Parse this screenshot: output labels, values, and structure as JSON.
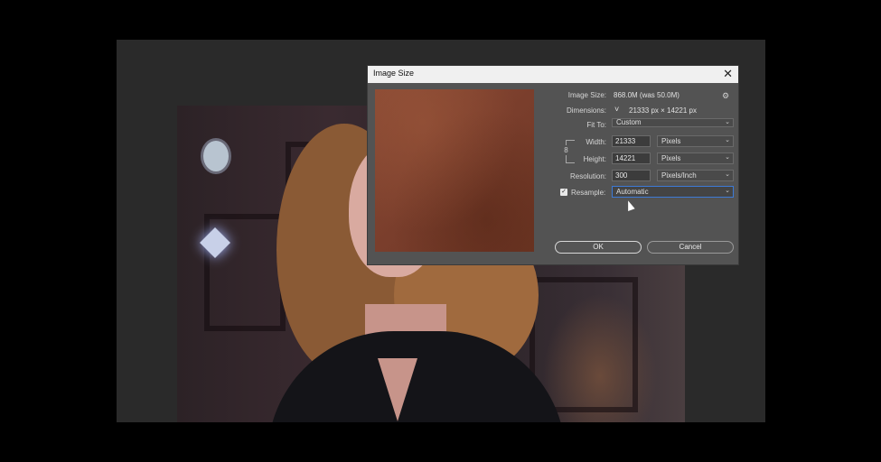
{
  "dialog": {
    "title": "Image Size",
    "close_glyph": "✕",
    "gear_glyph": "⚙",
    "image_size_label": "Image Size:",
    "image_size_value": "868.0M (was 50.0M)",
    "dimensions_label": "Dimensions:",
    "dimensions_chevron": "˅",
    "dimensions_value": "21333 px  ×  14221 px",
    "fit_to_label": "Fit To:",
    "fit_to_value": "Custom",
    "width_label": "Width:",
    "width_value": "21333",
    "width_unit": "Pixels",
    "height_label": "Height:",
    "height_value": "14221",
    "height_unit": "Pixels",
    "resolution_label": "Resolution:",
    "resolution_value": "300",
    "resolution_unit": "Pixels/Inch",
    "resample_label": "Resample:",
    "resample_checked": "✓",
    "resample_value": "Automatic",
    "ok_label": "OK",
    "cancel_label": "Cancel",
    "chain_glyph": "8"
  },
  "icons": {
    "close": "close-icon",
    "gear": "gear-icon",
    "chain": "link-chain-icon",
    "chevron": "chevron-down-icon",
    "cursor": "mouse-pointer-icon"
  },
  "colors": {
    "dialog_bg": "#535353",
    "titlebar_bg": "#f0f0f0",
    "focus_accent": "#3d7ad6"
  }
}
